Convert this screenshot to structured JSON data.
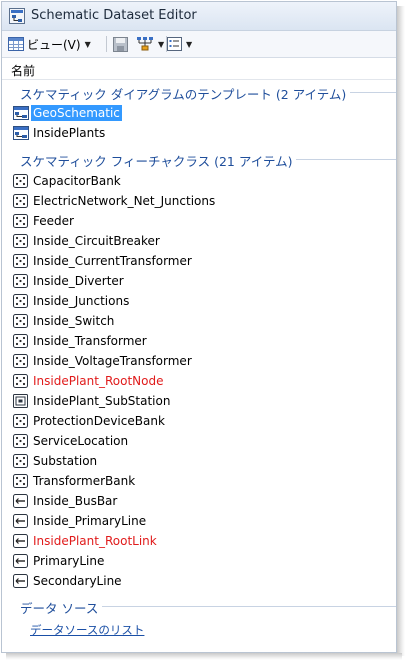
{
  "window": {
    "title": "Schematic Dataset Editor"
  },
  "toolbar": {
    "view_label": "ビュー(V)"
  },
  "list_header": {
    "column": "名前"
  },
  "groups": [
    {
      "label": "スケマティック ダイアグラムのテンプレート (2 アイテム)"
    },
    {
      "label": "スケマティック フィーチャクラス (21 アイテム)"
    },
    {
      "label": "データ ソース"
    }
  ],
  "templates": [
    {
      "name": "GeoSchematic",
      "icon": "diagram-template-icon",
      "selected": true
    },
    {
      "name": "InsidePlants",
      "icon": "diagram-template-icon",
      "selected": false
    }
  ],
  "feature_classes": [
    {
      "name": "CapacitorBank",
      "icon": "node-class-icon",
      "color": "#000000"
    },
    {
      "name": "ElectricNetwork_Net_Junctions",
      "icon": "node-class-icon",
      "color": "#000000"
    },
    {
      "name": "Feeder",
      "icon": "node-class-icon",
      "color": "#000000"
    },
    {
      "name": "Inside_CircuitBreaker",
      "icon": "node-class-icon",
      "color": "#000000"
    },
    {
      "name": "Inside_CurrentTransformer",
      "icon": "node-class-icon",
      "color": "#000000"
    },
    {
      "name": "Inside_Diverter",
      "icon": "node-class-icon",
      "color": "#000000"
    },
    {
      "name": "Inside_Junctions",
      "icon": "node-class-icon",
      "color": "#000000"
    },
    {
      "name": "Inside_Switch",
      "icon": "node-class-icon",
      "color": "#000000"
    },
    {
      "name": "Inside_Transformer",
      "icon": "node-class-icon",
      "color": "#000000"
    },
    {
      "name": "Inside_VoltageTransformer",
      "icon": "node-class-icon",
      "color": "#000000"
    },
    {
      "name": "InsidePlant_RootNode",
      "icon": "node-class-icon",
      "color": "#e01b1b"
    },
    {
      "name": "InsidePlant_SubStation",
      "icon": "node-on-node-class-icon",
      "color": "#000000"
    },
    {
      "name": "ProtectionDeviceBank",
      "icon": "node-class-icon",
      "color": "#000000"
    },
    {
      "name": "ServiceLocation",
      "icon": "node-class-icon",
      "color": "#000000"
    },
    {
      "name": "Substation",
      "icon": "node-class-icon",
      "color": "#000000"
    },
    {
      "name": "TransformerBank",
      "icon": "node-class-icon",
      "color": "#000000"
    },
    {
      "name": "Inside_BusBar",
      "icon": "link-class-icon",
      "color": "#000000"
    },
    {
      "name": "Inside_PrimaryLine",
      "icon": "link-class-icon",
      "color": "#000000"
    },
    {
      "name": "InsidePlant_RootLink",
      "icon": "link-class-icon",
      "color": "#e01b1b"
    },
    {
      "name": "PrimaryLine",
      "icon": "link-class-icon",
      "color": "#000000"
    },
    {
      "name": "SecondaryLine",
      "icon": "link-class-icon",
      "color": "#000000"
    }
  ],
  "data_source": {
    "link_text": "データソースのリスト"
  },
  "colors": {
    "accent": "#1f4e9b",
    "selection": "#3399ff",
    "warning_text": "#e01b1b"
  }
}
